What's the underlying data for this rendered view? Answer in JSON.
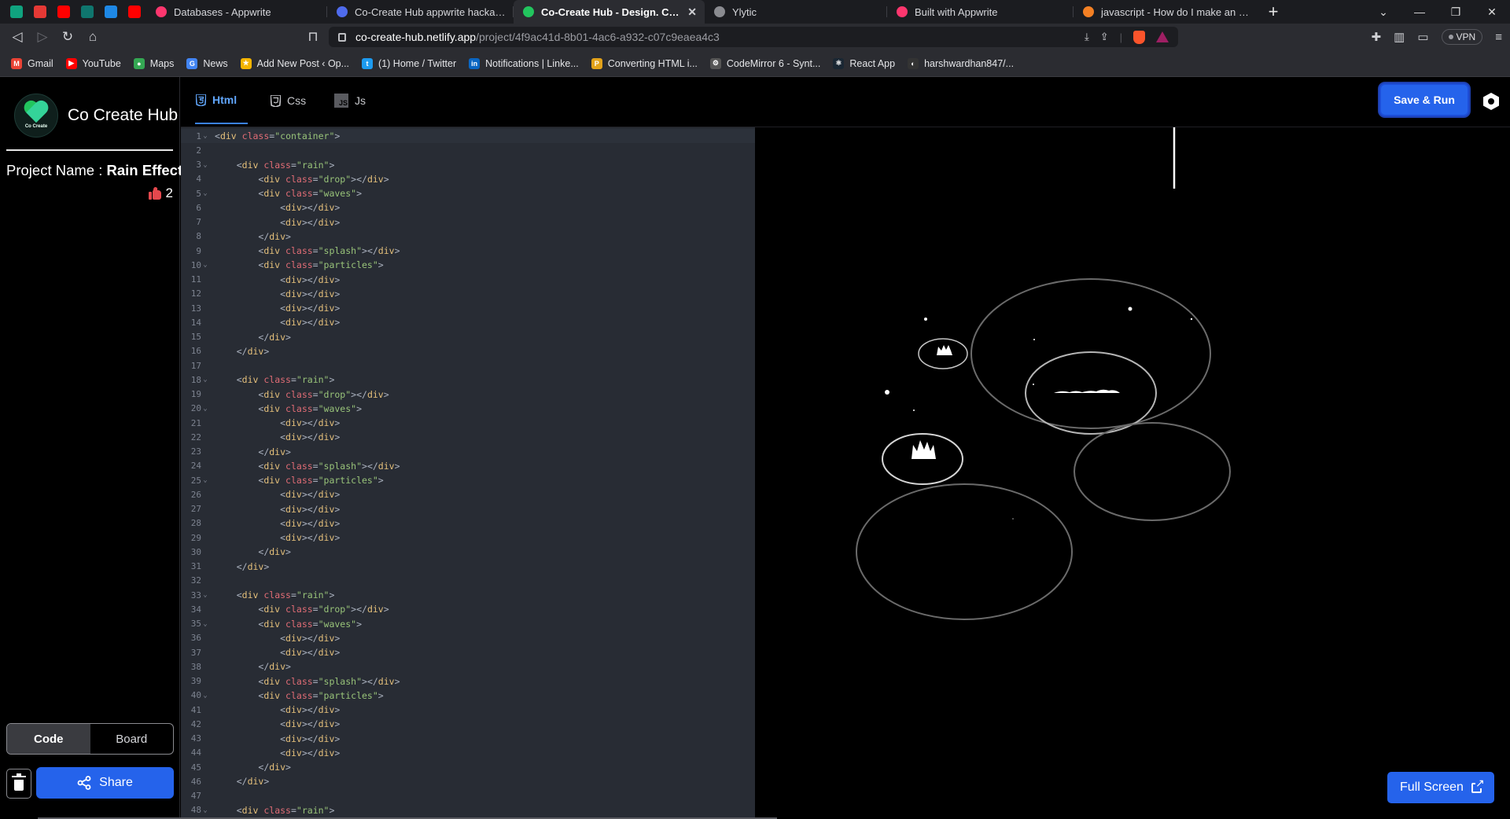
{
  "browser": {
    "tabs": [
      {
        "title": "Databases - Appwrite",
        "fav": "#fd366e"
      },
      {
        "title": "Co-Create Hub appwrite hackathon pr",
        "fav": "#4f6bed"
      },
      {
        "title": "Co-Create Hub - Design. Code. Co",
        "fav": "#22c55e",
        "active": true
      },
      {
        "title": "Ylytic",
        "fav": "#8a8b90"
      },
      {
        "title": "Built with Appwrite",
        "fav": "#fd366e"
      },
      {
        "title": "javascript - How do I make an array w",
        "fav": "#f48024"
      }
    ],
    "url_host": "co-create-hub.netlify.app",
    "url_path": "/project/4f9ac41d-8b01-4ac6-a932-c07c9eaea4c3",
    "vpn_label": "VPN",
    "bookmarks": [
      {
        "label": "Gmail",
        "color": "#ea4335",
        "glyph": "M"
      },
      {
        "label": "YouTube",
        "color": "#ff0000",
        "glyph": "▶"
      },
      {
        "label": "Maps",
        "color": "#34a853",
        "glyph": "●"
      },
      {
        "label": "News",
        "color": "#4285f4",
        "glyph": "G"
      },
      {
        "label": "Add New Post ‹ Op...",
        "color": "#f4b400",
        "glyph": "★"
      },
      {
        "label": "(1) Home / Twitter",
        "color": "#1d9bf0",
        "glyph": "t"
      },
      {
        "label": "Notifications | Linke...",
        "color": "#0a66c2",
        "glyph": "in"
      },
      {
        "label": "Converting HTML i...",
        "color": "#e3a21a",
        "glyph": "P"
      },
      {
        "label": "CodeMirror 6 - Synt...",
        "color": "#555",
        "glyph": "⚙"
      },
      {
        "label": "React App",
        "color": "#1a2733",
        "glyph": "⚛"
      },
      {
        "label": "harshwardhan847/...",
        "color": "#333",
        "glyph": "◐"
      }
    ]
  },
  "app": {
    "brand_name": "Co Create Hub",
    "brand_logo_text": "Co Create",
    "project_label": "Project Name : ",
    "project_name": "Rain Effect",
    "likes": "2",
    "view_toggle": {
      "code": "Code",
      "board": "Board"
    },
    "share_label": "Share",
    "editor_tabs": {
      "html": "Html",
      "css": "Css",
      "js": "Js"
    },
    "save_run_label": "Save & Run",
    "fullscreen_label": "Full Screen",
    "code_lines": [
      {
        "n": "1",
        "fold": true,
        "text": "<div class=\"container\">"
      },
      {
        "n": "2",
        "text": ""
      },
      {
        "n": "3",
        "fold": true,
        "text": "    <div class=\"rain\">"
      },
      {
        "n": "4",
        "text": "        <div class=\"drop\"></div>"
      },
      {
        "n": "5",
        "fold": true,
        "text": "        <div class=\"waves\">"
      },
      {
        "n": "6",
        "text": "            <div></div>"
      },
      {
        "n": "7",
        "text": "            <div></div>"
      },
      {
        "n": "8",
        "text": "        </div>"
      },
      {
        "n": "9",
        "text": "        <div class=\"splash\"></div>"
      },
      {
        "n": "10",
        "fold": true,
        "text": "        <div class=\"particles\">"
      },
      {
        "n": "11",
        "text": "            <div></div>"
      },
      {
        "n": "12",
        "text": "            <div></div>"
      },
      {
        "n": "13",
        "text": "            <div></div>"
      },
      {
        "n": "14",
        "text": "            <div></div>"
      },
      {
        "n": "15",
        "text": "        </div>"
      },
      {
        "n": "16",
        "text": "    </div>"
      },
      {
        "n": "17",
        "text": ""
      },
      {
        "n": "18",
        "fold": true,
        "text": "    <div class=\"rain\">"
      },
      {
        "n": "19",
        "text": "        <div class=\"drop\"></div>"
      },
      {
        "n": "20",
        "fold": true,
        "text": "        <div class=\"waves\">"
      },
      {
        "n": "21",
        "text": "            <div></div>"
      },
      {
        "n": "22",
        "text": "            <div></div>"
      },
      {
        "n": "23",
        "text": "        </div>"
      },
      {
        "n": "24",
        "text": "        <div class=\"splash\"></div>"
      },
      {
        "n": "25",
        "fold": true,
        "text": "        <div class=\"particles\">"
      },
      {
        "n": "26",
        "text": "            <div></div>"
      },
      {
        "n": "27",
        "text": "            <div></div>"
      },
      {
        "n": "28",
        "text": "            <div></div>"
      },
      {
        "n": "29",
        "text": "            <div></div>"
      },
      {
        "n": "30",
        "text": "        </div>"
      },
      {
        "n": "31",
        "text": "    </div>"
      },
      {
        "n": "32",
        "text": ""
      },
      {
        "n": "33",
        "fold": true,
        "text": "    <div class=\"rain\">"
      },
      {
        "n": "34",
        "text": "        <div class=\"drop\"></div>"
      },
      {
        "n": "35",
        "fold": true,
        "text": "        <div class=\"waves\">"
      },
      {
        "n": "36",
        "text": "            <div></div>"
      },
      {
        "n": "37",
        "text": "            <div></div>"
      },
      {
        "n": "38",
        "text": "        </div>"
      },
      {
        "n": "39",
        "text": "        <div class=\"splash\"></div>"
      },
      {
        "n": "40",
        "fold": true,
        "text": "        <div class=\"particles\">"
      },
      {
        "n": "41",
        "text": "            <div></div>"
      },
      {
        "n": "42",
        "text": "            <div></div>"
      },
      {
        "n": "43",
        "text": "            <div></div>"
      },
      {
        "n": "44",
        "text": "            <div></div>"
      },
      {
        "n": "45",
        "text": "        </div>"
      },
      {
        "n": "46",
        "text": "    </div>"
      },
      {
        "n": "47",
        "text": ""
      },
      {
        "n": "48",
        "fold": true,
        "text": "    <div class=\"rain\">"
      }
    ]
  }
}
